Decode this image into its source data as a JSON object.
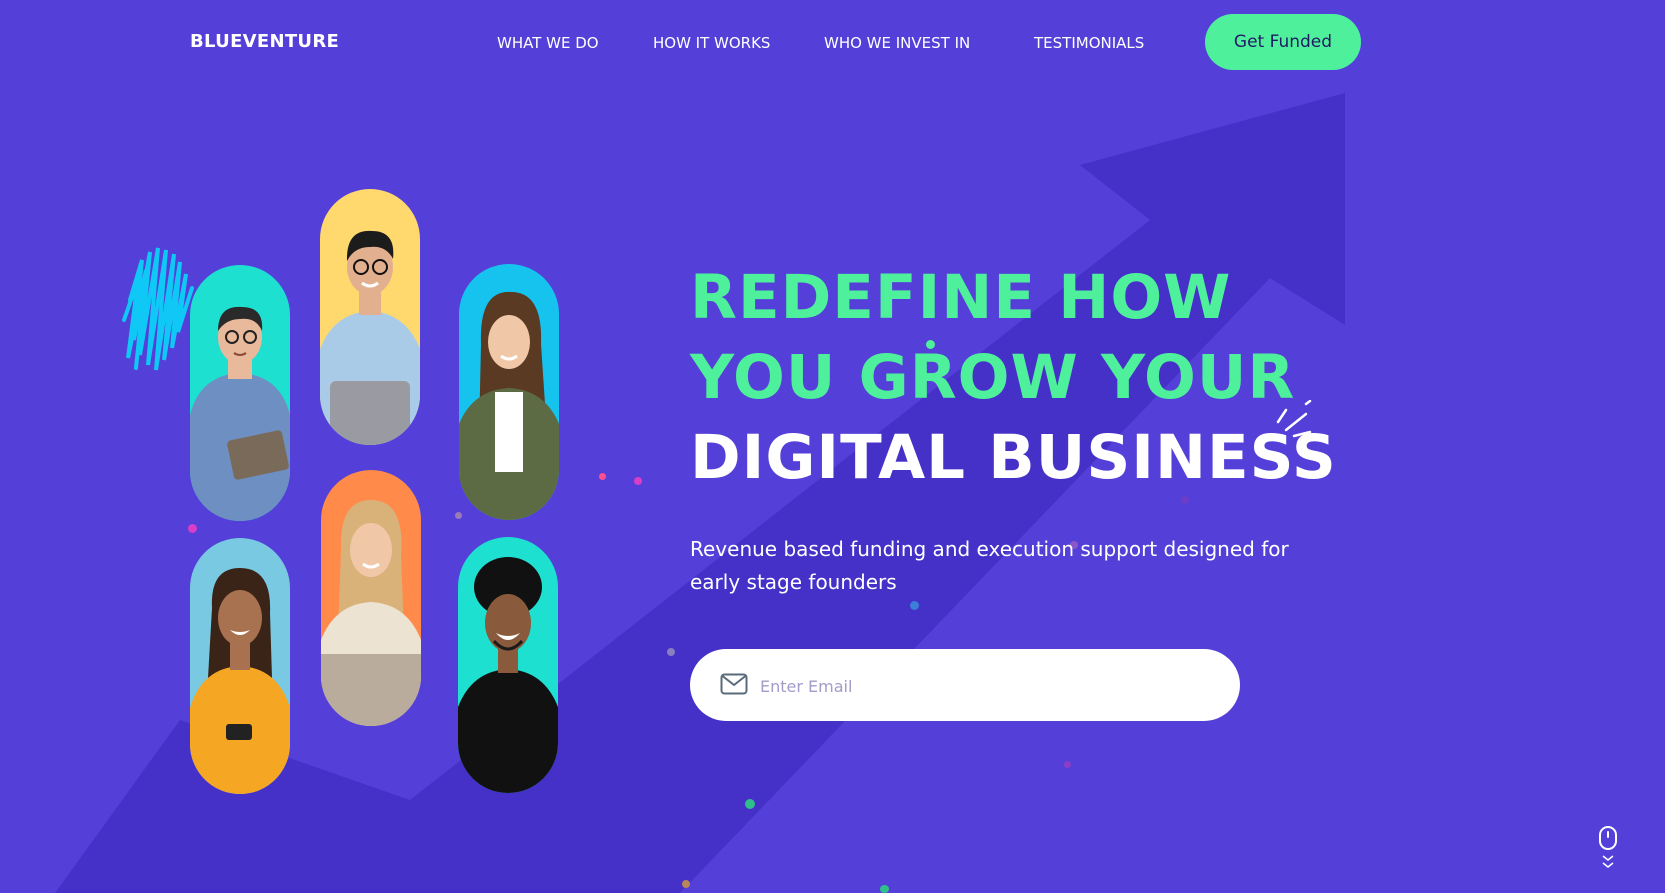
{
  "brand": {
    "name": "BLUEVENTURE"
  },
  "nav": {
    "items": [
      {
        "label": "WHAT WE DO"
      },
      {
        "label": "HOW IT WORKS"
      },
      {
        "label": "WHO WE INVEST IN"
      },
      {
        "label": "TESTIMONIALS"
      }
    ],
    "cta_label": "Get Funded"
  },
  "hero": {
    "title_line1": "REDEFINE HOW",
    "title_line2": "YOU GROW YOUR",
    "title_line3": "DIGITAL BUSINESS",
    "subtitle": "Revenue based funding and execution support designed for early stage founders",
    "email_placeholder": "Enter Email"
  },
  "colors": {
    "background": "#5440d8",
    "accent_green": "#4ff09b",
    "arrow_shade": "#4530c8",
    "text_white": "#ffffff"
  },
  "icons": {
    "mail": "mail-icon",
    "sparkle": "sparkle-icon",
    "scroll": "mouse-scroll-icon"
  },
  "portraits": [
    {
      "person": "man-glasses-tablet",
      "bg": "#1ee0d0",
      "shirt": "#6e8fc2",
      "skin": "#e8b99a",
      "hair": "#2a2a2a"
    },
    {
      "person": "woman-curly-phone",
      "bg": "#79c9e2",
      "shirt": "#f5a623",
      "skin": "#a8714f",
      "hair": "#3a2418"
    },
    {
      "person": "man-glasses-laptop",
      "bg": "#ffd96e",
      "shirt": "#a9cbe8",
      "skin": "#e2b08e",
      "hair": "#1c1c1c"
    },
    {
      "person": "woman-blonde-laptop",
      "bg": "#ff8a4a",
      "shirt": "#ede3d2",
      "skin": "#f0c8a8",
      "hair": "#d9b27a"
    },
    {
      "person": "woman-brown-hair",
      "bg": "#16c3ee",
      "shirt": "#5d6b45",
      "skin": "#f0c8a8",
      "hair": "#5a3a22"
    },
    {
      "person": "man-afro-smiling",
      "bg": "#1ee0d0",
      "shirt": "#111111",
      "skin": "#8a5a3c",
      "hair": "#111111"
    }
  ]
}
